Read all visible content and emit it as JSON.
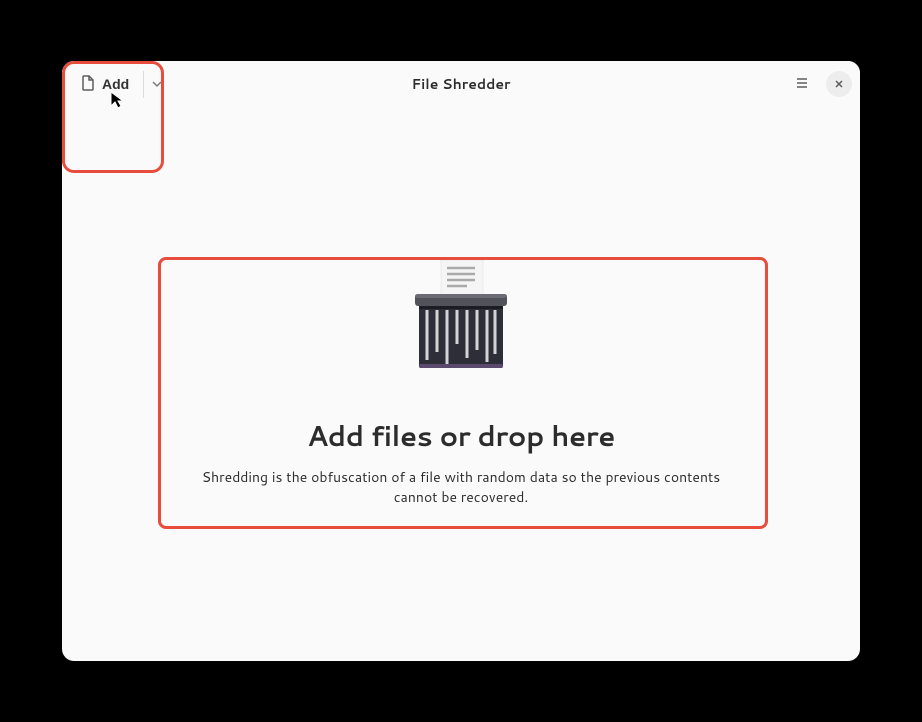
{
  "header": {
    "title": "File Shredder",
    "add_label": "Add"
  },
  "content": {
    "heading": "Add files or drop here",
    "description": "Shredding is the obfuscation of a file with random data so the previous contents cannot be recovered."
  }
}
